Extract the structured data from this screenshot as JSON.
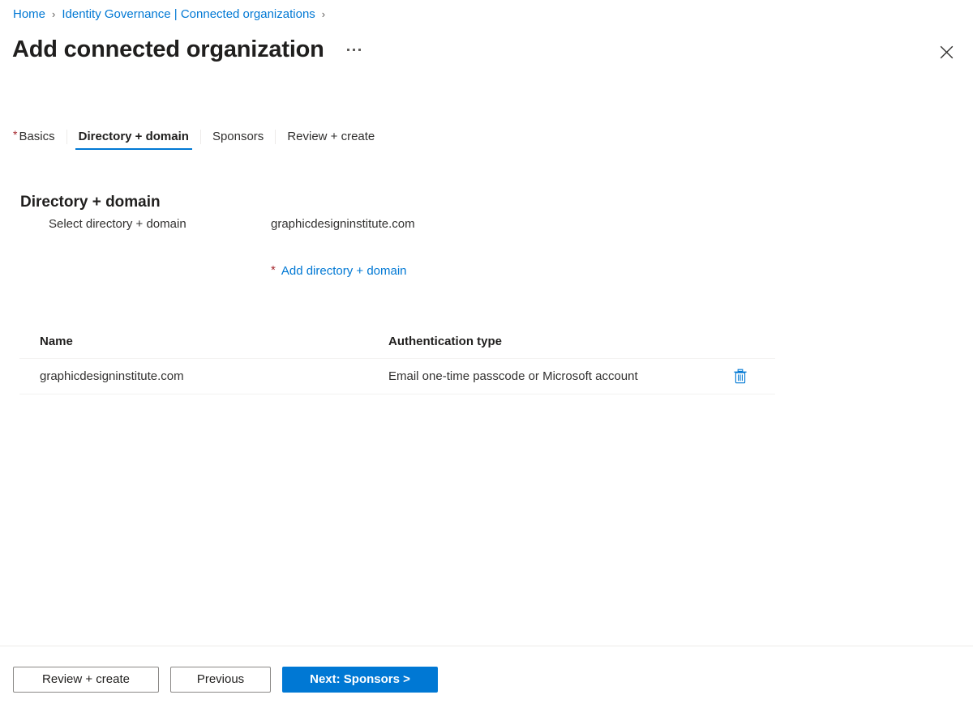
{
  "breadcrumb": {
    "items": [
      {
        "label": "Home",
        "icon": "chevron-right-icon"
      },
      {
        "label": "Identity Governance | Connected organizations",
        "icon": "chevron-right-icon"
      }
    ],
    "separator": "›"
  },
  "header": {
    "title": "Add connected organization",
    "more_menu_icon": "ellipsis-icon",
    "close_icon": "close-icon"
  },
  "tabs": [
    {
      "label": "Basics",
      "required": true,
      "active": false
    },
    {
      "label": "Directory + domain",
      "required": false,
      "active": true
    },
    {
      "label": "Sponsors",
      "required": false,
      "active": false
    },
    {
      "label": "Review + create",
      "required": false,
      "active": false
    }
  ],
  "section": {
    "heading": "Directory + domain",
    "field_label": "Select directory + domain",
    "field_value": "graphicdesigninstitute.com",
    "add_link_required_mark": "*",
    "add_link_label": "Add directory + domain"
  },
  "table": {
    "columns": [
      {
        "key": "name",
        "header": "Name"
      },
      {
        "key": "auth",
        "header": "Authentication type"
      },
      {
        "key": "action",
        "header": ""
      }
    ],
    "rows": [
      {
        "name": "graphicdesigninstitute.com",
        "auth": "Email one-time passcode or Microsoft account",
        "delete_icon": "trash-icon"
      }
    ]
  },
  "footer": {
    "review_create_label": "Review + create",
    "previous_label": "Previous",
    "next_label": "Next: Sponsors >"
  },
  "colors": {
    "accent": "#0078d4",
    "required_red": "#a4262c",
    "text_primary": "#201f1e",
    "text_secondary": "#323130",
    "border_light": "#edebe9",
    "grid_line": "#f3f2f1"
  }
}
